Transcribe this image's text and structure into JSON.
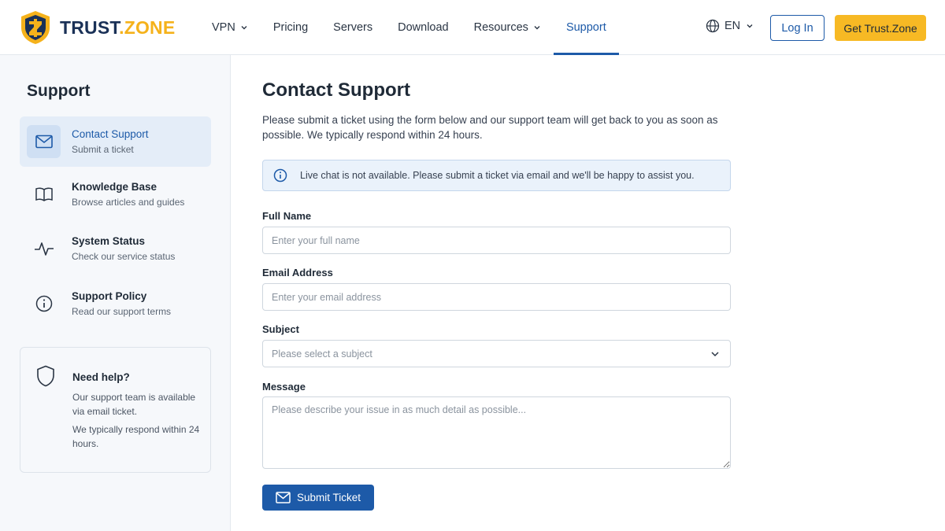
{
  "brand": {
    "name_main": "TRUST",
    "name_dot": ".",
    "name_zone": "ZONE",
    "logo_icon": "shield-logo-icon",
    "colors": {
      "primary": "#1d5aa8",
      "accent": "#f7b924",
      "navy": "#1a3157"
    }
  },
  "header": {
    "nav": [
      {
        "label": "VPN",
        "has_dropdown": true
      },
      {
        "label": "Pricing"
      },
      {
        "label": "Servers"
      },
      {
        "label": "Download"
      },
      {
        "label": "Resources",
        "has_dropdown": true
      },
      {
        "label": "Support",
        "active": true
      }
    ],
    "language": {
      "icon": "globe-icon",
      "label": "EN"
    },
    "login_label": "Log In",
    "cta_label": "Get Trust.Zone"
  },
  "sidebar": {
    "title": "Support",
    "items": [
      {
        "icon": "mail-icon",
        "label": "Contact Support",
        "sub": "Submit a ticket",
        "active": true
      },
      {
        "icon": "book-icon",
        "label": "Knowledge Base",
        "sub": "Browse articles and guides"
      },
      {
        "icon": "activity-icon",
        "label": "System Status",
        "sub": "Check our service status"
      },
      {
        "icon": "info-icon",
        "label": "Support Policy",
        "sub": "Read our support terms"
      }
    ],
    "help": {
      "icon": "shield-icon",
      "title": "Need help?",
      "text1": "Our support team is available via email ticket.",
      "text2": "We typically respond within 24 hours."
    }
  },
  "main": {
    "title": "Contact Support",
    "intro": "Please submit a ticket using the form below and our support team will get back to you as soon as possible. We typically respond within 24 hours.",
    "notice": "Live chat is not available. Please submit a ticket via email and we'll be happy to assist you.",
    "form": {
      "name_label": "Full Name",
      "name_placeholder": "Enter your full name",
      "email_label": "Email Address",
      "email_placeholder": "Enter your email address",
      "subject_label": "Subject",
      "subject_placeholder": "Please select a subject",
      "message_label": "Message",
      "message_placeholder": "Please describe your issue in as much detail as possible...",
      "submit_label": "Submit Ticket"
    }
  }
}
